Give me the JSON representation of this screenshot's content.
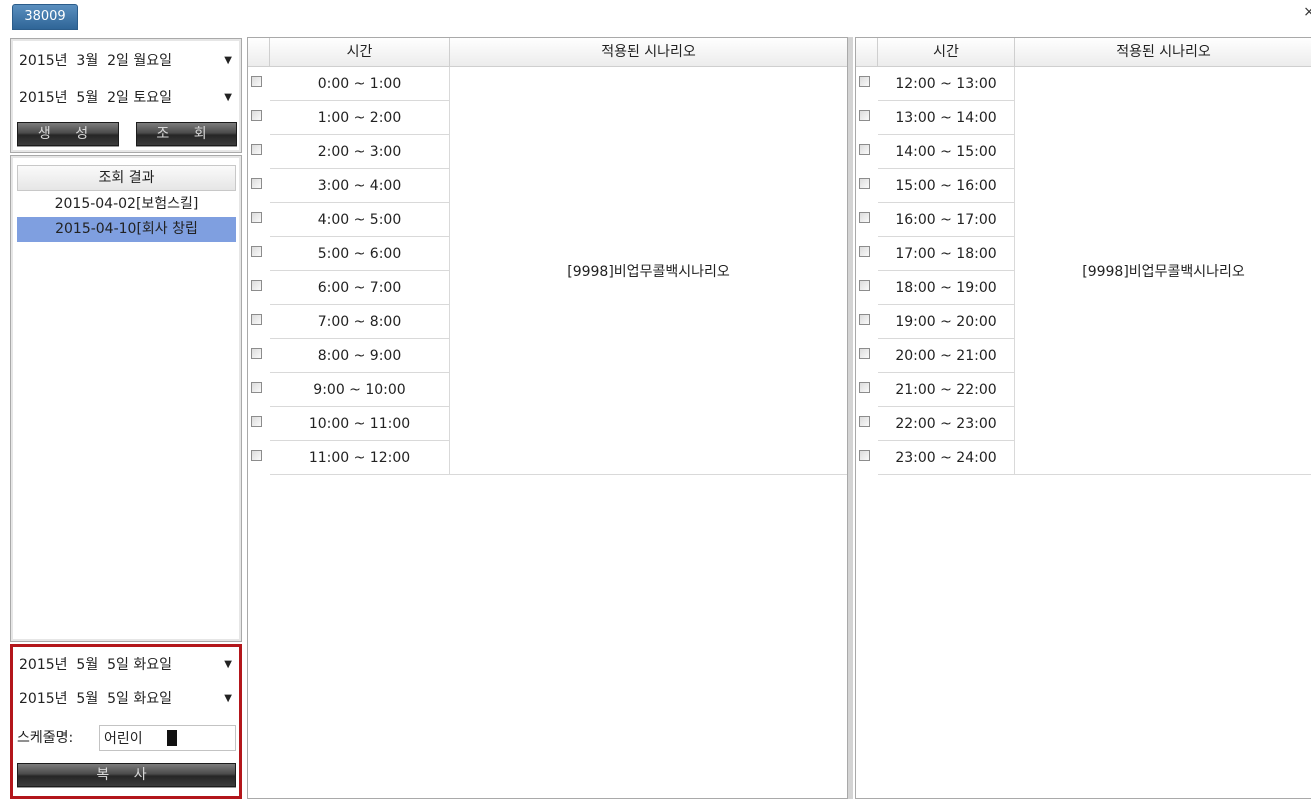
{
  "tab": {
    "label": "38009",
    "close": "×"
  },
  "left": {
    "top": {
      "start_date": "2015년  3월  2일 월요일",
      "end_date": "2015년  5월  2일 토요일",
      "create_btn": "생 성",
      "query_btn": "조 회"
    },
    "results": {
      "header": "조회 결과",
      "items": [
        "2015-04-02[보험스킬]",
        "2015-04-10[회사 창립"
      ],
      "selected_index": 1
    },
    "copy": {
      "start_date": "2015년  5월  5일 화요일",
      "end_date": "2015년  5월  5일 화요일",
      "schedule_label": "스케줄명:",
      "schedule_value": "어린이",
      "copy_btn": "복 사"
    }
  },
  "grid_left": {
    "headers": {
      "time": "시간",
      "scenario": "적용된 시나리오"
    },
    "times": [
      "0:00 ~ 1:00",
      "1:00 ~ 2:00",
      "2:00 ~ 3:00",
      "3:00 ~ 4:00",
      "4:00 ~ 5:00",
      "5:00 ~ 6:00",
      "6:00 ~ 7:00",
      "7:00 ~ 8:00",
      "8:00 ~ 9:00",
      "9:00 ~ 10:00",
      "10:00 ~ 11:00",
      "11:00 ~ 12:00"
    ],
    "scenario": "[9998]비업무콜백시나리오"
  },
  "grid_right": {
    "headers": {
      "time": "시간",
      "scenario": "적용된 시나리오"
    },
    "times": [
      "12:00 ~ 13:00",
      "13:00 ~ 14:00",
      "14:00 ~ 15:00",
      "15:00 ~ 16:00",
      "16:00 ~ 17:00",
      "17:00 ~ 18:00",
      "18:00 ~ 19:00",
      "19:00 ~ 20:00",
      "20:00 ~ 21:00",
      "21:00 ~ 22:00",
      "22:00 ~ 23:00",
      "23:00 ~ 24:00"
    ],
    "scenario": "[9998]비업무콜백시나리오"
  },
  "colors": {
    "selected_row": "#7f9fe0",
    "copy_panel_border": "#b3161b",
    "tab": "#2f6597"
  }
}
